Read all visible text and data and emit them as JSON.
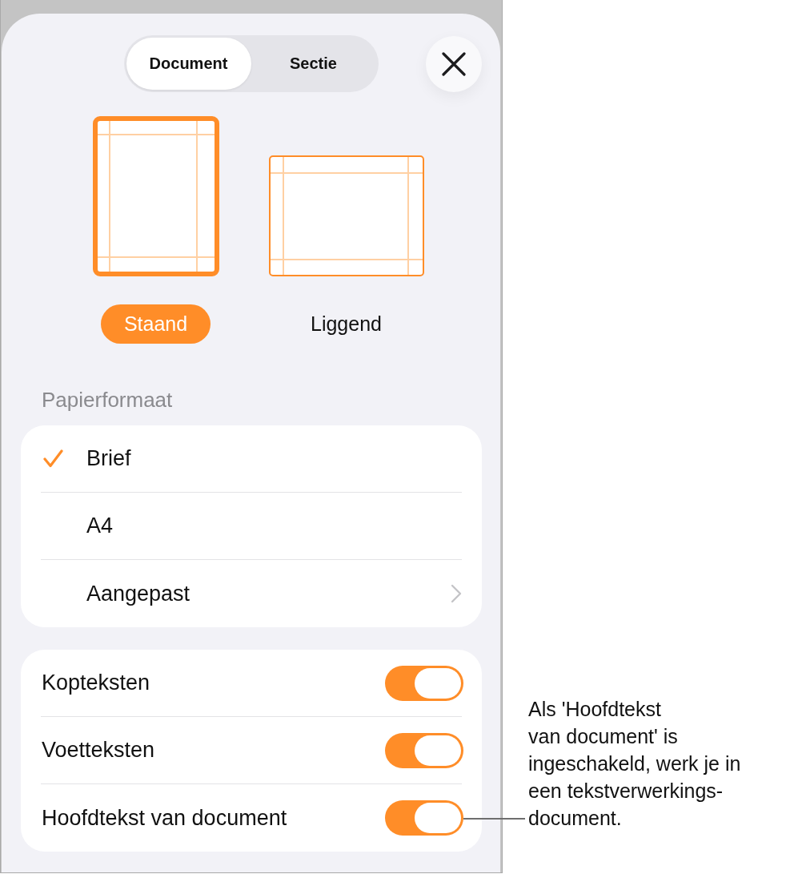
{
  "tabs": [
    {
      "label": "Document",
      "selected": true
    },
    {
      "label": "Sectie",
      "selected": false
    }
  ],
  "orientations": [
    {
      "kind": "portrait",
      "label": "Staand",
      "selected": true
    },
    {
      "kind": "landscape",
      "label": "Liggend",
      "selected": false
    }
  ],
  "paper_size": {
    "title": "Papierformaat",
    "options": [
      {
        "kind": "choice",
        "label": "Brief",
        "selected": true
      },
      {
        "kind": "choice",
        "label": "A4",
        "selected": false
      },
      {
        "kind": "submenu",
        "label": "Aangepast",
        "selected": false
      }
    ]
  },
  "settings": [
    {
      "label": "Kopteksten",
      "on": true
    },
    {
      "label": "Voetteksten",
      "on": true
    },
    {
      "label": "Hoofdtekst van document",
      "on": true
    }
  ],
  "callout": {
    "text": "Als 'Hoofdtekst\nvan document' is\ningeschakeld, werk je in\neen tekstverwerkings-\ndocument."
  }
}
